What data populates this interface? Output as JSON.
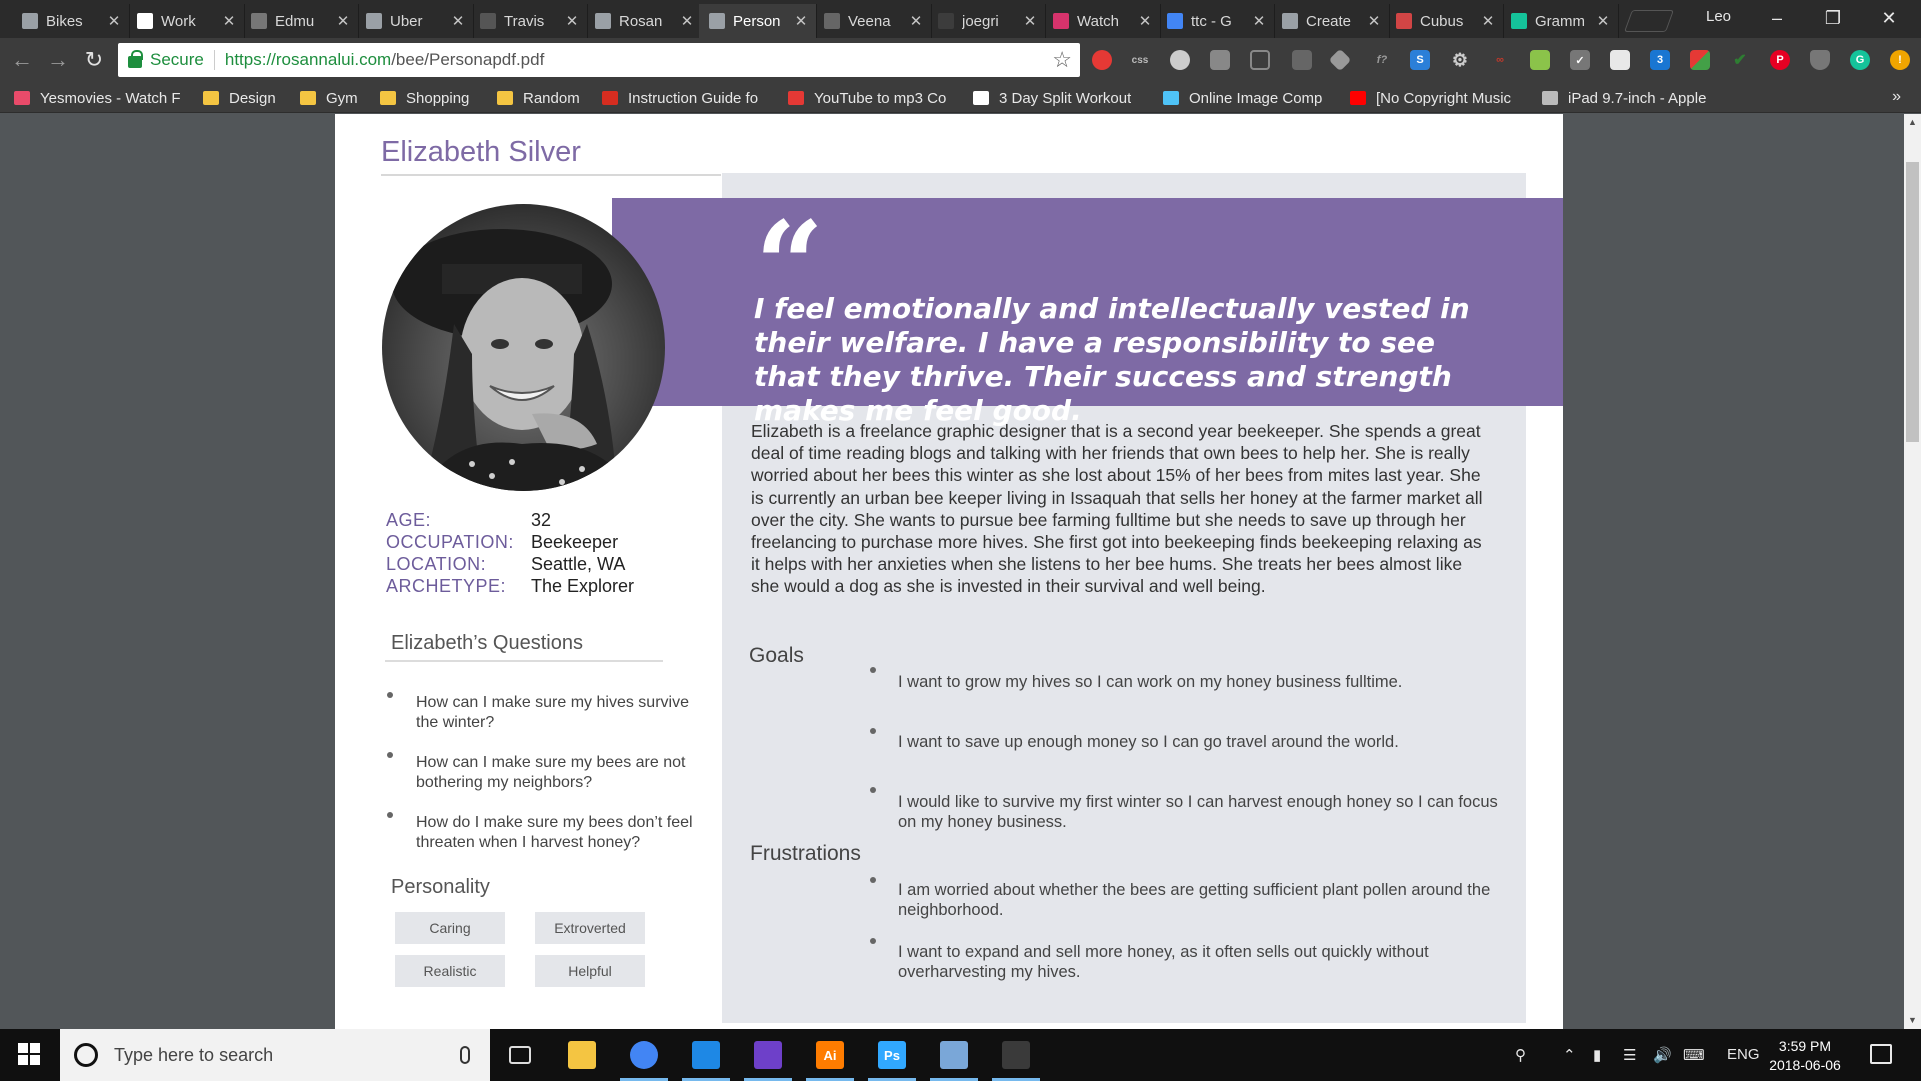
{
  "browser": {
    "tabs": [
      {
        "title": "Bikes",
        "icon": "page-icon",
        "color": "#9aa0a6"
      },
      {
        "title": "Work",
        "icon": "z-icon",
        "color": "#ffffff"
      },
      {
        "title": "Edmu",
        "icon": "yuux-icon",
        "color": "#777777"
      },
      {
        "title": "Uber",
        "icon": "page-icon",
        "color": "#9aa0a6"
      },
      {
        "title": "Travis",
        "icon": "travis-icon",
        "color": "#555555"
      },
      {
        "title": "Rosan",
        "icon": "page-icon",
        "color": "#9aa0a6"
      },
      {
        "title": "Person",
        "icon": "page-icon",
        "color": "#9aa0a6",
        "active": true
      },
      {
        "title": "Veena",
        "icon": "vr-icon",
        "color": "#666666"
      },
      {
        "title": "joegri",
        "icon": "blank-icon",
        "color": "#3c3c3c"
      },
      {
        "title": "Watch",
        "icon": "hd-icon",
        "color": "#d6336c"
      },
      {
        "title": "ttc - G",
        "icon": "google-icon",
        "color": "#4285f4"
      },
      {
        "title": "Create",
        "icon": "page-icon",
        "color": "#9aa0a6"
      },
      {
        "title": "Cubus",
        "icon": "cubus-icon",
        "color": "#d14545"
      },
      {
        "title": "Gramm",
        "icon": "grammarly-icon",
        "color": "#15c39a"
      }
    ],
    "profile_name": "Leo",
    "omnibox": {
      "secure_label": "Secure",
      "url_host": "https://rosannalui.com",
      "url_path": "/bee/Personapdf.pdf"
    },
    "bookmarks": [
      {
        "label": "Yesmovies - Watch F",
        "color": "#e94b6a"
      },
      {
        "label": "Design",
        "color": "#f4c542"
      },
      {
        "label": "Gym",
        "color": "#f4c542"
      },
      {
        "label": "Shopping",
        "color": "#f4c542"
      },
      {
        "label": "Random",
        "color": "#f4c542"
      },
      {
        "label": "Instruction Guide fo",
        "color": "#d62d20"
      },
      {
        "label": "YouTube to mp3 Co",
        "color": "#e53935"
      },
      {
        "label": "3 Day Split Workout",
        "color": "#ffffff"
      },
      {
        "label": "Online Image Comp",
        "color": "#4fc3f7"
      },
      {
        "label": "[No Copyright Music",
        "color": "#ff0000"
      },
      {
        "label": "iPad 9.7-inch - Apple",
        "color": "#bbbbbb"
      }
    ],
    "bookmarks_more": "»"
  },
  "persona": {
    "name": "Elizabeth Silver",
    "details": [
      {
        "label": "AGE:",
        "value": "32"
      },
      {
        "label": "OCCUPATION:",
        "value": "Beekeeper"
      },
      {
        "label": "LOCATION:",
        "value": "Seattle, WA"
      },
      {
        "label": "ARCHETYPE:",
        "value": "The Explorer"
      }
    ],
    "questions_title": "Elizabeth’s Questions",
    "questions": [
      "How can I make sure my hives survive the winter?",
      "How can I make sure my bees are not bothering my neighbors?",
      "How do I make sure my bees don’t feel threaten when I harvest honey?"
    ],
    "personality_title": "Personality",
    "personality": [
      "Caring",
      "Extroverted",
      "Realistic",
      "Helpful"
    ],
    "quote_mark": "“",
    "quote": "I feel emotionally and intellectually vested in their welfare. I have a responsibility to see that they thrive. Their success and strength makes me feel good.",
    "bio": "Elizabeth is a freelance graphic designer that is a second year beekeeper. She spends a great deal of time reading blogs and talking with her friends that own bees to help her. She is really worried about her bees this winter as she lost about 15% of her bees from mites last year. She is currently an urban bee keeper living in Issaquah that sells her honey at the farmer market all over the city. She wants to pursue bee farming fulltime but she needs to save up through her freelancing to purchase more hives. She first got into beekeeping finds beekeeping relaxing as it helps with her anxieties when she listens to her bee hums. She treats her bees almost like she would a dog as she is invested in their survival and well being.",
    "goals_title": "Goals",
    "goals": [
      "I want to grow my hives so I can work on my honey business fulltime.",
      "I want to save up enough money so I can go travel around the world.",
      "I would like to survive my first winter so I can harvest enough honey so I can focus on my honey business."
    ],
    "frustrations_title": "Frustrations",
    "frustrations": [
      "I am worried about whether the bees are getting sufficient plant pollen around the neighborhood.",
      "I want to expand and sell more honey, as it often sells out quickly without overharvesting my hives."
    ],
    "accent_color": "#7e6aa5"
  },
  "taskbar": {
    "search_placeholder": "Type here to search",
    "apps": [
      {
        "name": "task-view",
        "label": "",
        "color": "#101010"
      },
      {
        "name": "file-explorer",
        "label": "",
        "color": "#f4c542"
      },
      {
        "name": "chrome",
        "label": "",
        "color": "#4285f4",
        "open": true
      },
      {
        "name": "visual-app",
        "label": "",
        "color": "#1e88e5",
        "open": true
      },
      {
        "name": "github-desktop",
        "label": "",
        "color": "#6e40c9",
        "open": true
      },
      {
        "name": "illustrator",
        "label": "Ai",
        "color": "#ff7c00",
        "open": true
      },
      {
        "name": "photoshop",
        "label": "Ps",
        "color": "#31a8ff",
        "open": true
      },
      {
        "name": "photos",
        "label": "",
        "color": "#7aa7d8",
        "open": true
      },
      {
        "name": "calculator",
        "label": "",
        "color": "#3a3a3a",
        "open": true
      }
    ],
    "language": "ENG",
    "time": "3:59 PM",
    "date": "2018-06-06"
  }
}
